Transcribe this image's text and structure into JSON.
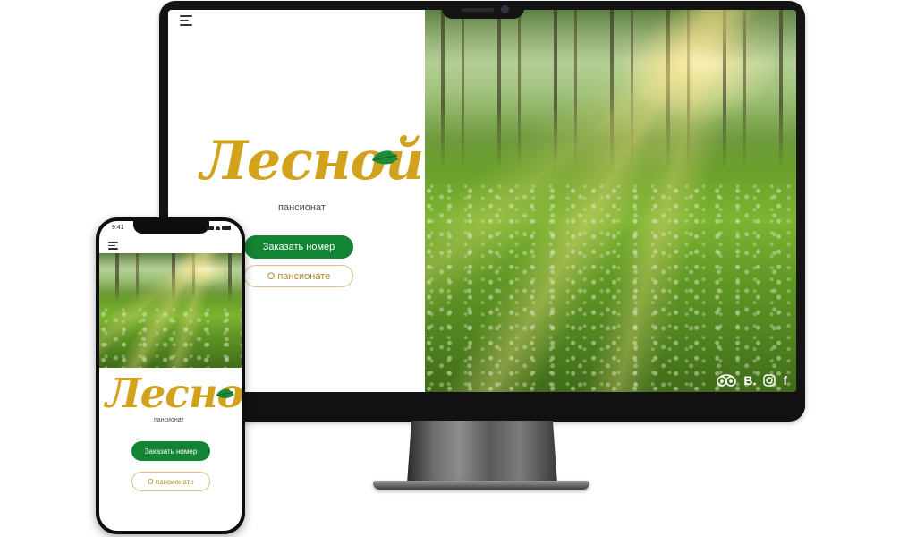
{
  "desktop": {
    "menu_icon": "hamburger-icon",
    "logo": {
      "word": "Лесной",
      "subtitle": "пансионат",
      "leaf_icon": "oak-leaf-icon"
    },
    "buttons": {
      "book": "Заказать номер",
      "about": "О пансионате"
    },
    "social": [
      {
        "name": "tripadvisor-icon"
      },
      {
        "name": "booking-icon",
        "text": "B."
      },
      {
        "name": "instagram-icon"
      },
      {
        "name": "facebook-icon",
        "text": "f"
      }
    ],
    "hero_image": "sunlit-forest-meadow"
  },
  "mobile": {
    "status_time": "9:41",
    "menu_icon": "hamburger-icon",
    "logo": {
      "word": "Лесной",
      "subtitle": "пансионат",
      "leaf_icon": "oak-leaf-icon"
    },
    "buttons": {
      "book": "Заказать номер",
      "about": "О пансионате"
    },
    "hero_image": "sunlit-forest-meadow"
  },
  "colors": {
    "brand_gold": "#d3a21d",
    "brand_green": "#128434",
    "leaf_green": "#1f8a3a",
    "outline_gold": "#d9c58a"
  }
}
